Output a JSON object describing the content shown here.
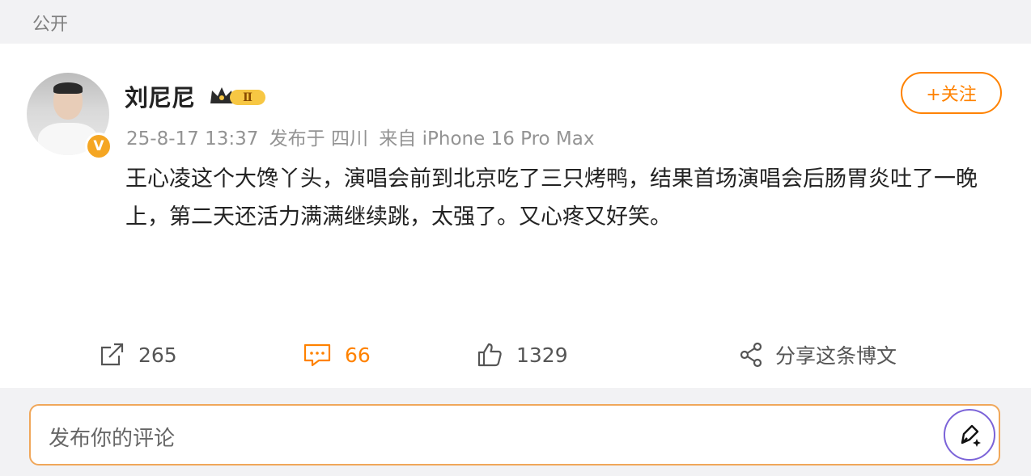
{
  "header": {
    "visibility_label": "公开"
  },
  "post": {
    "author": {
      "name": "刘尼尼",
      "verified_badge_icon": "verified-v-icon",
      "level_badge_icon": "crown-level-badge-icon",
      "level_text": "Ⅱ"
    },
    "follow_label": "+关注",
    "meta": {
      "time": "25-8-17 13:37",
      "location": "发布于 四川",
      "device": "来自 iPhone 16 Pro Max"
    },
    "content": "王心凌这个大馋丫头，演唱会前到北京吃了三只烤鸭，结果首场演唱会后肠胃炎吐了一晚上，第二天还活力满满继续跳，太强了。又心疼又好笑。"
  },
  "actions": [
    {
      "icon": "repost-icon",
      "label": "265"
    },
    {
      "icon": "comment-icon",
      "label": "66"
    },
    {
      "icon": "like-icon",
      "label": "1329"
    },
    {
      "icon": "share-icon",
      "label": "分享这条博文"
    }
  ],
  "comment_box": {
    "placeholder": "发布你的评论",
    "submit_icon": "pen-sparkle-icon"
  },
  "colors": {
    "accent": "#ff8200",
    "verified": "#f5a623",
    "pen_border": "#7b63d8"
  }
}
